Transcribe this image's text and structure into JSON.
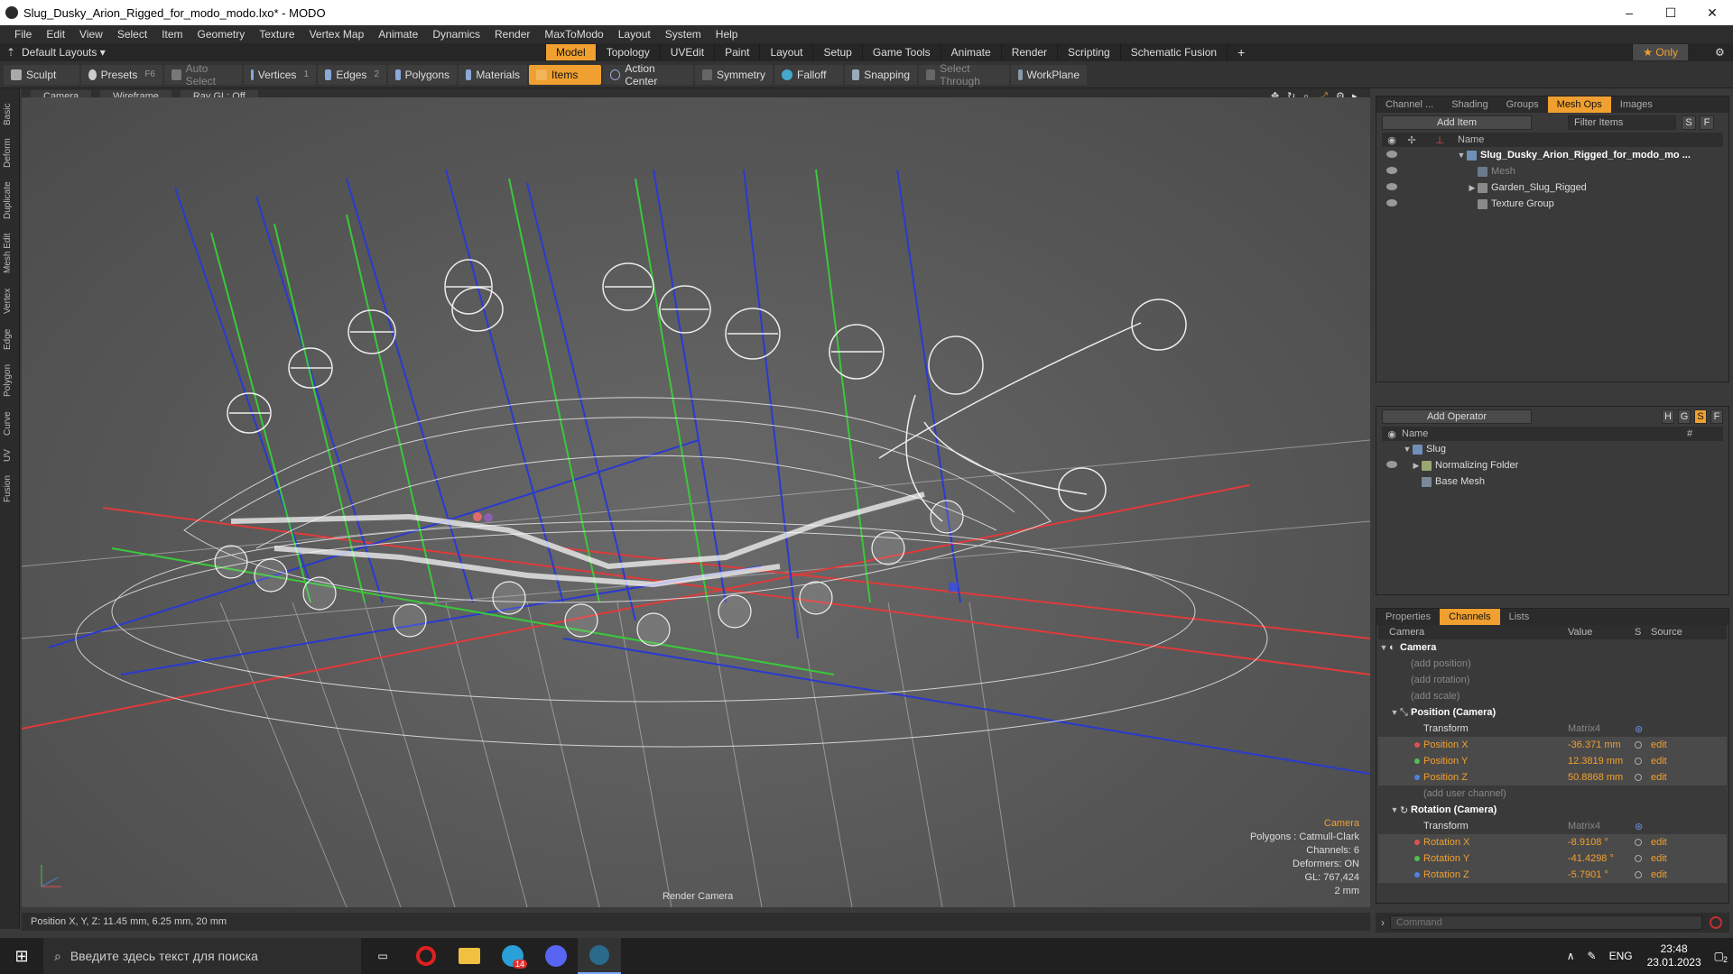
{
  "window": {
    "title": "Slug_Dusky_Arion_Rigged_for_modo_modo.lxo* - MODO",
    "minimize": "–",
    "maximize": "☐",
    "close": "✕"
  },
  "menu": [
    "File",
    "Edit",
    "View",
    "Select",
    "Item",
    "Geometry",
    "Texture",
    "Vertex Map",
    "Animate",
    "Dynamics",
    "Render",
    "MaxToModo",
    "Layout",
    "System",
    "Help"
  ],
  "layouts": {
    "default_label": "Default Layouts ▾",
    "tabs": [
      "Model",
      "Topology",
      "UVEdit",
      "Paint",
      "Layout",
      "Setup",
      "Game Tools",
      "Animate",
      "Render",
      "Scripting",
      "Schematic Fusion"
    ],
    "active_tab": "Model",
    "add": "+",
    "only": "★ Only"
  },
  "toolbar": {
    "sculpt": "Sculpt",
    "presets": "Presets",
    "presets_key": "F6",
    "auto_select": "Auto Select",
    "vertices": "Vertices",
    "vertices_count": "1",
    "edges": "Edges",
    "edges_count": "2",
    "polygons": "Polygons",
    "materials": "Materials",
    "items": "Items",
    "action_center": "Action Center",
    "symmetry": "Symmetry",
    "falloff": "Falloff",
    "snapping": "Snapping",
    "select_through": "Select Through",
    "workplane": "WorkPlane"
  },
  "left_strip": [
    "Basic",
    "Deform",
    "Duplicate",
    "Mesh Edit",
    "Vertex",
    "Edge",
    "Polygon",
    "Curve",
    "UV",
    "Fusion"
  ],
  "viewport": {
    "camera": "Camera",
    "shading": "Wireframe",
    "raygl": "Ray GL: Off",
    "hud": {
      "title": "Camera",
      "polygons": "Polygons : Catmull-Clark",
      "channels": "Channels: 6",
      "deformers": "Deformers: ON",
      "gl": "GL: 767,424",
      "scale": "2 mm"
    },
    "render_camera": "Render Camera"
  },
  "status": "Position X, Y, Z:  11.45 mm, 6.25 mm, 20 mm",
  "items_panel": {
    "tabs": [
      "Channel ...",
      "Shading",
      "Groups",
      "Mesh Ops",
      "Images"
    ],
    "active_tab": "Mesh Ops",
    "add_item": "Add Item",
    "filter_items": "Filter Items",
    "s": "S",
    "f": "F",
    "col_name": "Name",
    "rows": [
      {
        "name": "Slug_Dusky_Arion_Rigged_for_modo_mo ...",
        "dim": false,
        "bold": true,
        "indent": 0,
        "expand": "▼"
      },
      {
        "name": "Mesh",
        "dim": true,
        "bold": false,
        "indent": 1,
        "expand": ""
      },
      {
        "name": "Garden_Slug_Rigged",
        "dim": false,
        "bold": false,
        "indent": 1,
        "expand": "▶"
      },
      {
        "name": "Texture Group",
        "dim": false,
        "bold": false,
        "indent": 1,
        "expand": ""
      }
    ]
  },
  "meshops_panel": {
    "add_operator": "Add Operator",
    "h": "H",
    "g": "G",
    "s": "S",
    "f": "F",
    "col_name": "Name",
    "col_hash": "#",
    "rows": [
      {
        "name": "Slug",
        "indent": 0,
        "expand": "▼"
      },
      {
        "name": "Normalizing Folder",
        "indent": 1,
        "expand": "▶"
      },
      {
        "name": "Base Mesh",
        "indent": 1,
        "expand": ""
      }
    ]
  },
  "channels_panel": {
    "tabs": [
      "Properties",
      "Channels",
      "Lists"
    ],
    "active_tab": "Channels",
    "col_name": "Camera",
    "col_value": "Value",
    "col_s": "S",
    "col_source": "Source",
    "rows": [
      {
        "name": "Camera",
        "value": "",
        "source": "",
        "type": "group",
        "indent": 0
      },
      {
        "name": "(add position)",
        "value": "",
        "source": "",
        "type": "dim",
        "indent": 1
      },
      {
        "name": "(add rotation)",
        "value": "",
        "source": "",
        "type": "dim",
        "indent": 1
      },
      {
        "name": "(add scale)",
        "value": "",
        "source": "",
        "type": "dim",
        "indent": 1
      },
      {
        "name": "Position (Camera)",
        "value": "",
        "source": "",
        "type": "group",
        "indent": 1
      },
      {
        "name": "Transform",
        "value": "Matrix4",
        "source": "",
        "type": "plain",
        "indent": 2
      },
      {
        "name": "Position X",
        "value": "-36.371 mm",
        "source": "edit",
        "type": "chan",
        "color": "#e05050",
        "indent": 2
      },
      {
        "name": "Position Y",
        "value": "12.3819 mm",
        "source": "edit",
        "type": "chan",
        "color": "#50c050",
        "indent": 2
      },
      {
        "name": "Position Z",
        "value": "50.8868 mm",
        "source": "edit",
        "type": "chan",
        "color": "#5080e0",
        "indent": 2
      },
      {
        "name": "(add user channel)",
        "value": "",
        "source": "",
        "type": "dim",
        "indent": 2
      },
      {
        "name": "Rotation (Camera)",
        "value": "",
        "source": "",
        "type": "group",
        "indent": 1
      },
      {
        "name": "Transform",
        "value": "Matrix4",
        "source": "",
        "type": "plain",
        "indent": 2
      },
      {
        "name": "Rotation X",
        "value": "-8.9108 °",
        "source": "edit",
        "type": "chan",
        "color": "#e05050",
        "indent": 2
      },
      {
        "name": "Rotation Y",
        "value": "-41.4298 °",
        "source": "edit",
        "type": "chan",
        "color": "#50c050",
        "indent": 2
      },
      {
        "name": "Rotation Z",
        "value": "-5.7901 °",
        "source": "edit",
        "type": "chan",
        "color": "#5080e0",
        "indent": 2
      }
    ]
  },
  "command": {
    "placeholder": "Command"
  },
  "taskbar": {
    "search_placeholder": "Введите здесь текст для поиска",
    "telegram_badge": "14",
    "lang": "ENG",
    "time": "23:48",
    "date": "23.01.2023",
    "notif": "2"
  },
  "colors": {
    "accent": "#f0a030",
    "bg": "#3a3a3a"
  }
}
